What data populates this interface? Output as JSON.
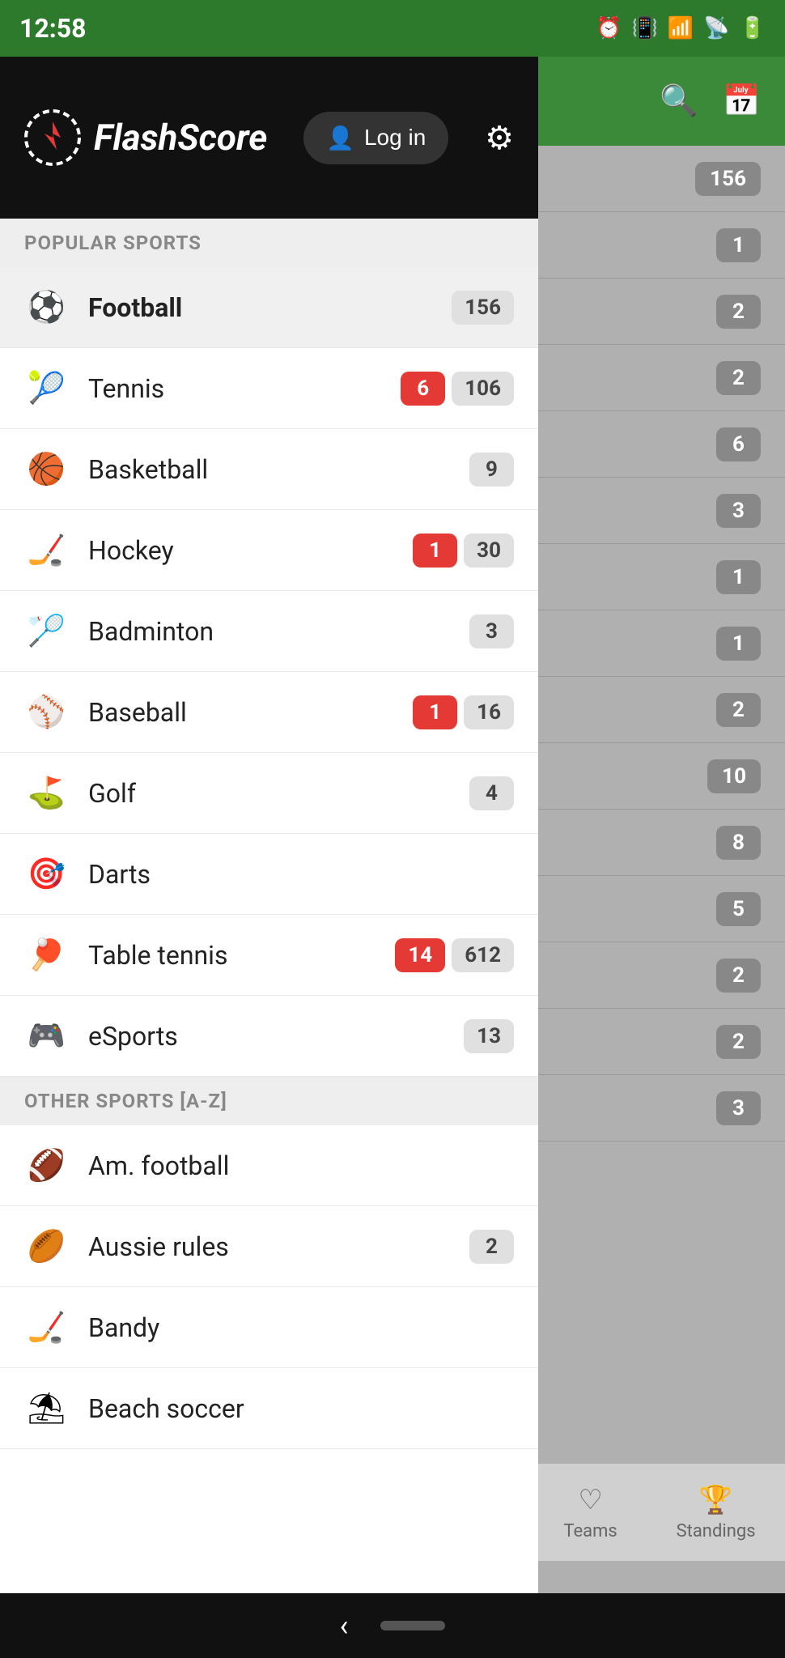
{
  "statusBar": {
    "time": "12:58"
  },
  "header": {
    "searchIconLabel": "search",
    "calendarIconLabel": "calendar"
  },
  "drawer": {
    "appName": "FlashScore",
    "loginButton": "Log in",
    "settingsIconLabel": "settings"
  },
  "sections": {
    "popular": "POPULAR SPORTS",
    "others": "OTHER SPORTS [A-Z]"
  },
  "popularSports": [
    {
      "name": "Football",
      "icon": "⚽",
      "active": true,
      "badgeRed": null,
      "badgeGray": "156"
    },
    {
      "name": "Tennis",
      "icon": "🎾",
      "active": false,
      "badgeRed": "6",
      "badgeGray": "106"
    },
    {
      "name": "Basketball",
      "icon": "🏀",
      "active": false,
      "badgeRed": null,
      "badgeGray": "9"
    },
    {
      "name": "Hockey",
      "icon": "🏒",
      "active": false,
      "badgeRed": "1",
      "badgeGray": "30"
    },
    {
      "name": "Badminton",
      "icon": "🏸",
      "active": false,
      "badgeRed": null,
      "badgeGray": "3"
    },
    {
      "name": "Baseball",
      "icon": "⚾",
      "active": false,
      "badgeRed": "1",
      "badgeGray": "16"
    },
    {
      "name": "Golf",
      "icon": "⛳",
      "active": false,
      "badgeRed": null,
      "badgeGray": "4"
    },
    {
      "name": "Darts",
      "icon": "🎯",
      "active": false,
      "badgeRed": null,
      "badgeGray": null
    },
    {
      "name": "Table tennis",
      "icon": "🏓",
      "active": false,
      "badgeRed": "14",
      "badgeGray": "612"
    },
    {
      "name": "eSports",
      "icon": "🎮",
      "active": false,
      "badgeRed": null,
      "badgeGray": "13"
    }
  ],
  "otherSports": [
    {
      "name": "Am. football",
      "icon": "🏈",
      "badgeRed": null,
      "badgeGray": null
    },
    {
      "name": "Aussie rules",
      "icon": "🏉",
      "badgeRed": null,
      "badgeGray": "2"
    },
    {
      "name": "Bandy",
      "icon": "🏒",
      "badgeRed": null,
      "badgeGray": null
    },
    {
      "name": "Beach soccer",
      "icon": "⛱",
      "badgeRed": null,
      "badgeGray": null
    }
  ],
  "rightNumbers": [
    "156",
    "1",
    "2",
    "2",
    "6",
    "3",
    "1",
    "1",
    "2",
    "10",
    "8",
    "5",
    "2",
    "2",
    "3"
  ],
  "bottomTabs": [
    {
      "icon": "♡",
      "label": "Teams"
    },
    {
      "icon": "🏆",
      "label": "Standings"
    }
  ],
  "navBar": {
    "back": "‹"
  }
}
